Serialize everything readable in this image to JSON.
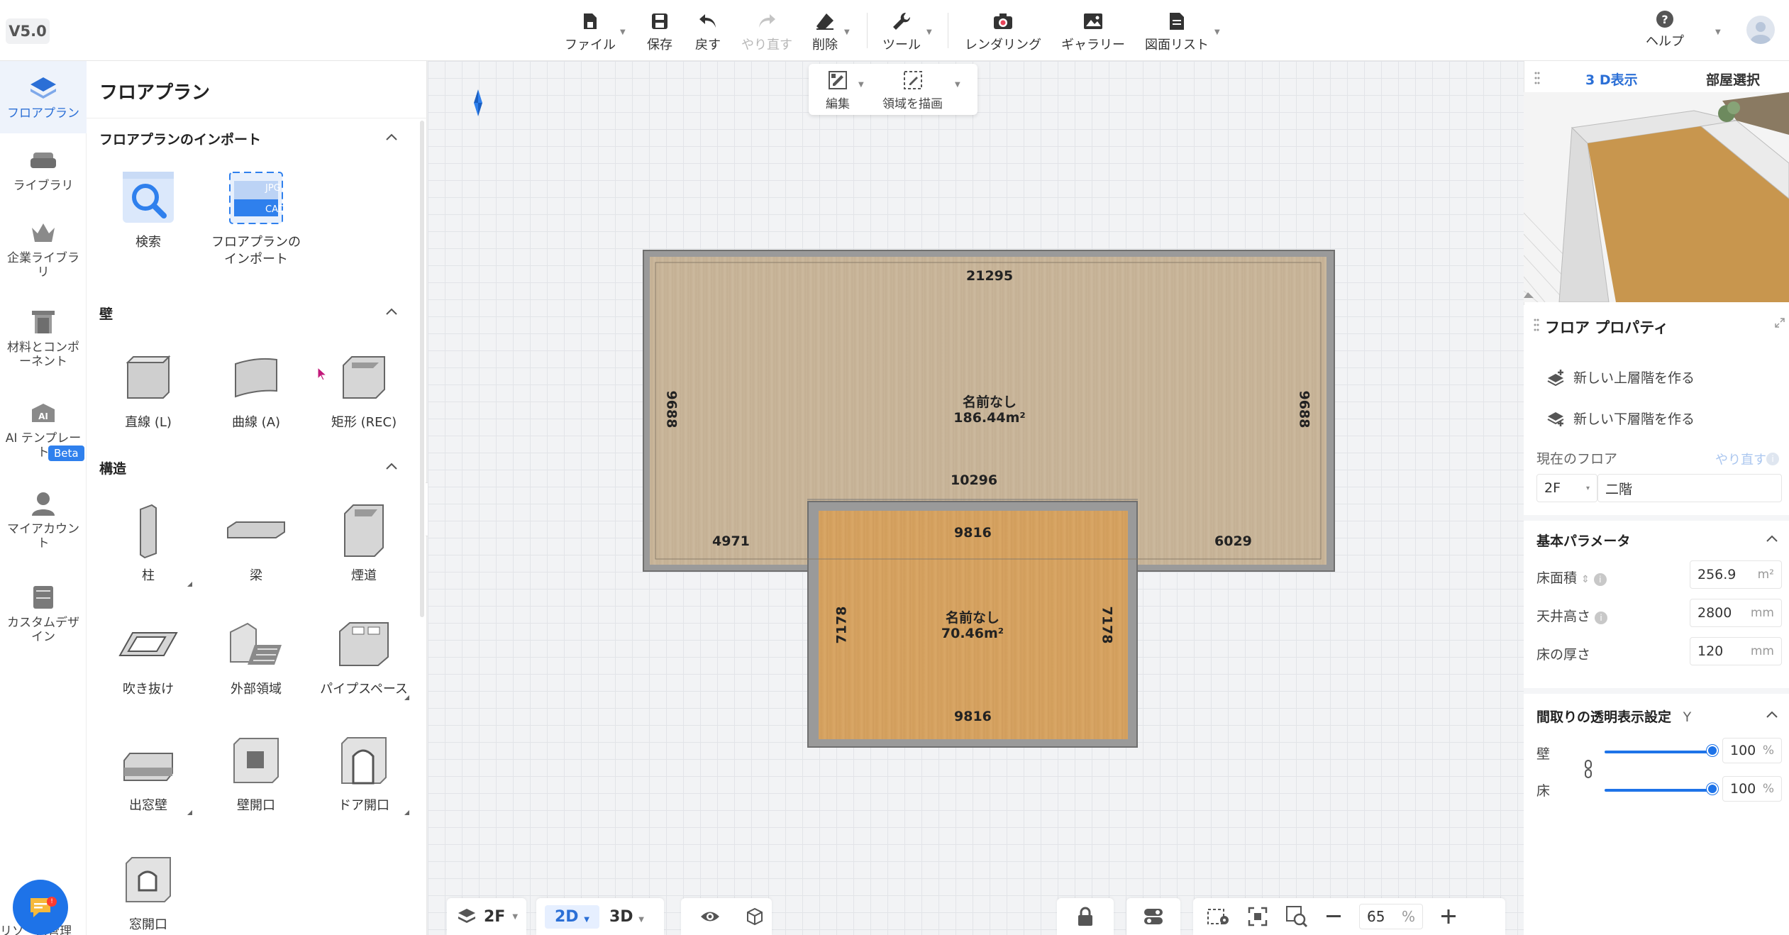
{
  "app": {
    "version": "V5.0"
  },
  "toolbar": {
    "file": "ファイル",
    "save": "保存",
    "undo": "戻す",
    "redo": "やり直す",
    "delete": "削除",
    "tools": "ツール",
    "render": "レンダリング",
    "gallery": "ギャラリー",
    "drawing_list": "図面リスト",
    "help": "ヘルプ"
  },
  "rail": {
    "items": [
      {
        "label": "フロアプラン",
        "active": true
      },
      {
        "label": "ライブラリ"
      },
      {
        "label": "企業ライブラリ"
      },
      {
        "label": "材料とコンポーネント"
      },
      {
        "label": "AI テンプレート",
        "badge": "Beta"
      },
      {
        "label": "マイアカウント"
      },
      {
        "label": "カスタムデザイン"
      }
    ],
    "bottom_cut": "リソース管理"
  },
  "left_panel": {
    "title": "フロアプラン",
    "import_section": "フロアプランのインポート",
    "import_tools": [
      {
        "label": "検索"
      },
      {
        "label": "フロアプランの インポート",
        "tag_top": "JPG",
        "tag_bottom": "CAD"
      }
    ],
    "wall_section": "壁",
    "wall_tools": [
      {
        "label": "直線 (L)"
      },
      {
        "label": "曲線 (A)"
      },
      {
        "label": "矩形 (REC)"
      }
    ],
    "structure_section": "構造",
    "structure_tools": [
      {
        "label": "柱"
      },
      {
        "label": "梁"
      },
      {
        "label": "煙道"
      },
      {
        "label": "吹き抜け"
      },
      {
        "label": "外部領域"
      },
      {
        "label": "パイプスペース"
      },
      {
        "label": "出窓壁"
      },
      {
        "label": "壁開口"
      },
      {
        "label": "ドア開口"
      },
      {
        "label": "窓開口"
      }
    ]
  },
  "canvas": {
    "float_bar": {
      "edit": "編集",
      "draw_area": "領域を描画"
    },
    "rooms": [
      {
        "name": "名前なし",
        "area": "186.44m²"
      },
      {
        "name": "名前なし",
        "area": "70.46m²"
      }
    ],
    "dimensions": {
      "top": "21295",
      "left": "9688",
      "right": "9688",
      "mid": "10296",
      "bottom_left": "4971",
      "bottom_right": "6029",
      "lower_top": "9816",
      "lower_bottom": "9816",
      "lower_left": "7178",
      "lower_right": "7178"
    }
  },
  "bottom_bar": {
    "floor": "2F",
    "mode_2d": "2D",
    "mode_3d": "3D",
    "zoom": "65",
    "zoom_unit": "%"
  },
  "right_panel": {
    "tabs": {
      "view3d": "3 D表示",
      "room_select": "部屋選択"
    },
    "props_title": "フロア プロパティ",
    "new_upper": "新しい上層階を作る",
    "new_lower": "新しい下層階を作る",
    "current_floor_label": "現在のフロア",
    "redo": "やり直す",
    "floor_code": "2F",
    "floor_name": "二階",
    "basic_params": "基本パラメータ",
    "floor_area_label": "床面積",
    "floor_area_value": "256.9",
    "floor_area_unit": "m²",
    "ceiling_label": "天井高さ",
    "ceiling_value": "2800",
    "ceiling_unit": "mm",
    "thickness_label": "床の厚さ",
    "thickness_value": "120",
    "thickness_unit": "mm",
    "transparency_title": "間取りの透明表示設定",
    "transparency_key": "Y",
    "wall_label": "壁",
    "wall_value": "100",
    "floor_label": "床",
    "floor_value": "100",
    "percent": "%"
  },
  "colors": {
    "accent": "#1e73e8",
    "floor_main": "#c9b69a",
    "floor_sub": "#d6a362"
  }
}
